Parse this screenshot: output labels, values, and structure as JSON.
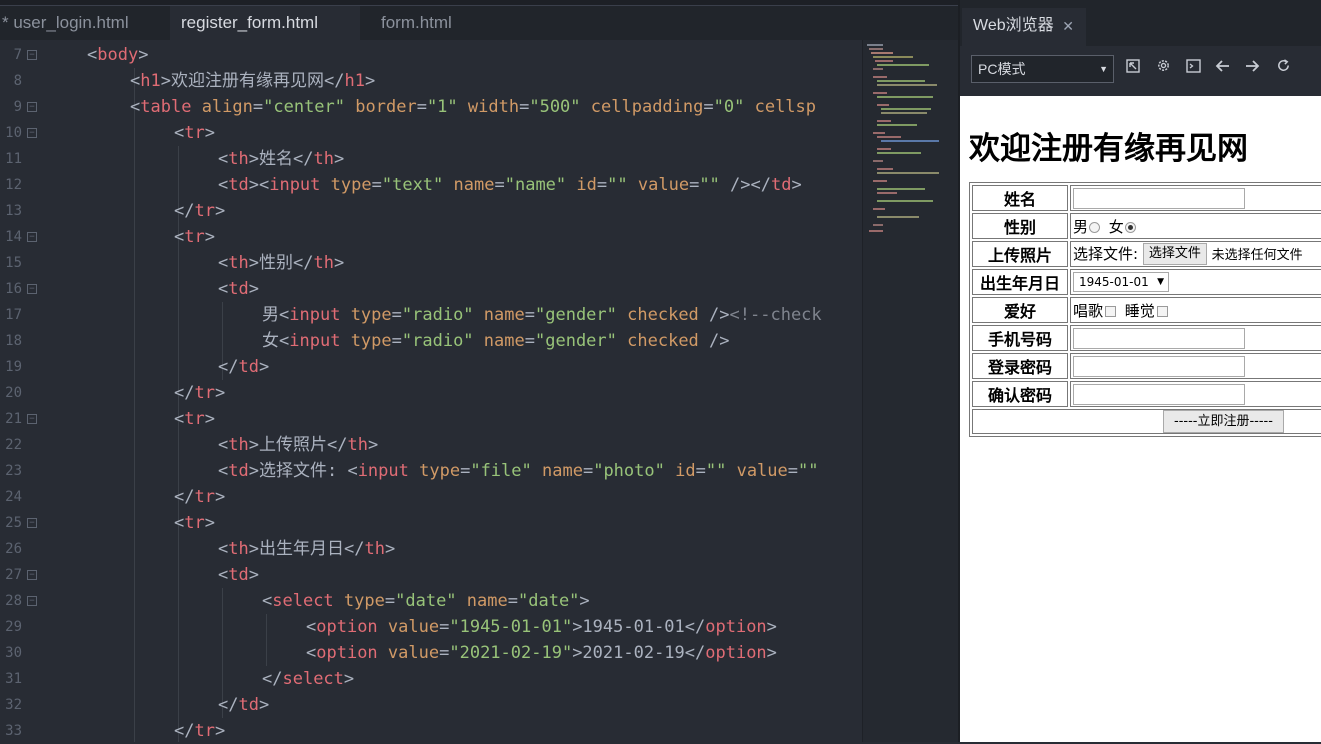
{
  "editor": {
    "tabs": [
      {
        "label": "* user_login.html"
      },
      {
        "label": "register_form.html"
      },
      {
        "label": "form.html"
      }
    ],
    "line_numbers": [
      "7",
      "8",
      "9",
      "10",
      "11",
      "12",
      "13",
      "14",
      "15",
      "16",
      "17",
      "18",
      "19",
      "20",
      "21",
      "22",
      "23",
      "24",
      "25",
      "26",
      "27",
      "28",
      "29",
      "30",
      "31",
      "32",
      "33"
    ]
  },
  "browser": {
    "tab_title": "Web浏览器",
    "mode_select": "PC模式",
    "heading": "欢迎注册有缘再见网",
    "form": {
      "name_label": "姓名",
      "gender_label": "性别",
      "gender_male": "男",
      "gender_female": "女",
      "photo_label": "上传照片",
      "photo_prefix": "选择文件:",
      "photo_button": "选择文件",
      "photo_status": "未选择任何文件",
      "birth_label": "出生年月日",
      "birth_value": "1945-01-01",
      "hobby_label": "爱好",
      "hobby_1": "唱歌",
      "hobby_2": "睡觉",
      "phone_label": "手机号码",
      "password_label": "登录密码",
      "confirm_label": "确认密码",
      "submit": "-----立即注册-----"
    }
  }
}
